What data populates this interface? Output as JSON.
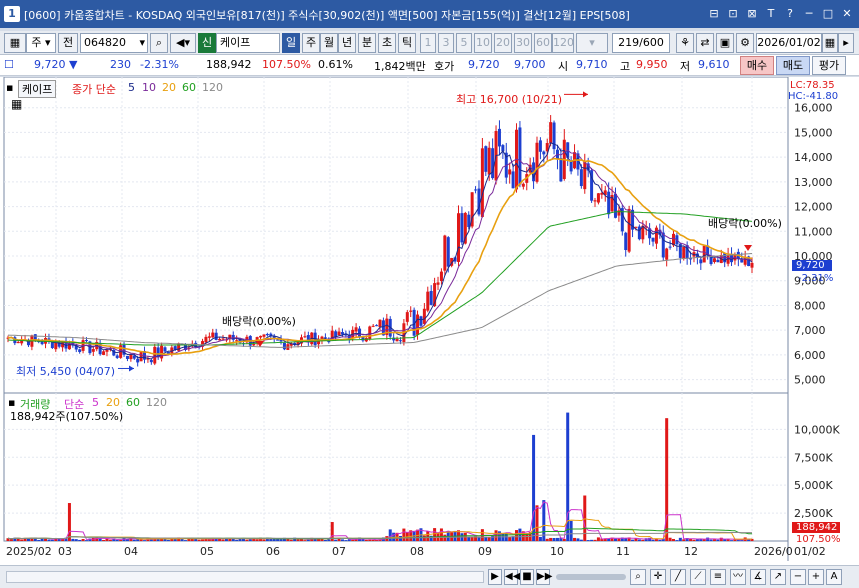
{
  "window": {
    "number": "1",
    "title": "[0600] 카움종합차트 - KOSDAQ 외국인보유[817(천)] 주식수[30,902(천)] 액면[500] 자본금[155(억)] 결산[12월] EPS[508]",
    "buttons": [
      "⊟",
      "⊡",
      "⊠",
      "T",
      "?",
      "─",
      "□",
      "✕"
    ]
  },
  "toolbar": {
    "market": "주",
    "all_label": "전",
    "code": "064820",
    "sin_label": "신",
    "name": "케이프",
    "periods": [
      "일",
      "주",
      "월",
      "년",
      "분",
      "초",
      "틱"
    ],
    "intervals": [
      "1",
      "3",
      "5",
      "10",
      "20",
      "30",
      "60",
      "120"
    ],
    "count": "219/600",
    "date": "2026/01/02"
  },
  "quote": {
    "price": "9,720",
    "change": "230",
    "change_pct": "-2.31%",
    "volume": "188,942",
    "volume_ratio": "107.50%",
    "turnover": "0.61%",
    "amount": "1,842백만",
    "ask_label": "호가",
    "ask1": "9,720",
    "ask2": "9,700",
    "open_label": "시",
    "open": "9,710",
    "high_label": "고",
    "high": "9,950",
    "low_label": "저",
    "low": "9,610",
    "buy_label": "매수",
    "sell_label": "매도",
    "eval_label": "평가"
  },
  "price_legend": {
    "name": "케이프",
    "type": "종가 단순",
    "ma": [
      "5",
      "10",
      "20",
      "60",
      "120"
    ]
  },
  "volume_legend": {
    "name": "거래량",
    "type": "단순",
    "ma": [
      "5",
      "20",
      "60",
      "120"
    ],
    "value": "188,942주(107.50%)"
  },
  "annotations": {
    "high": "최고 16,700 (10/21)",
    "low": "최저 5,450 (04/07)",
    "dividend1": "배당락(0.00%)",
    "dividend2": "배당락(0.00%)",
    "lc": "LC:78.35",
    "hc": "HC:-41.80",
    "price_box": "9,720",
    "price_pct": "-2.31%",
    "vol_box": "188,942",
    "vol_pct": "107.50%"
  },
  "axis": {
    "price_ticks": [
      "16,000",
      "15,000",
      "14,000",
      "13,000",
      "12,000",
      "11,000",
      "10,000",
      "9,000",
      "8,000",
      "7,000",
      "6,000",
      "5,000"
    ],
    "volume_ticks": [
      "10,000K",
      "7,500K",
      "5,000K",
      "2,500K"
    ],
    "x_ticks": [
      "2025/02",
      "03",
      "04",
      "05",
      "06",
      "07",
      "08",
      "09",
      "10",
      "11",
      "12",
      "2026/0",
      "01/02"
    ]
  },
  "colors": {
    "up": "#e01818",
    "down": "#1d3fd0",
    "ma5": "#1a2a8a",
    "ma10": "#7a2a9a",
    "ma20": "#e8a010",
    "ma60": "#22a022",
    "ma120": "#8a8a8a",
    "vol_ma5": "#cc33cc",
    "vol_ma20": "#e8a010",
    "vol_ma60": "#22a022",
    "vol_ma120": "#8a8a8a"
  },
  "chart_data": {
    "type": "candlestick",
    "period": "daily",
    "price_range": [
      4700,
      17000
    ],
    "volume_range": [
      0,
      12000000
    ],
    "months": [
      "2025/02",
      "03",
      "04",
      "05",
      "06",
      "07",
      "08",
      "09",
      "10",
      "11",
      "12",
      "01/02"
    ],
    "monthly_close": [
      6700,
      6400,
      5900,
      6700,
      6500,
      6800,
      7300,
      13500,
      14500,
      11200,
      10200,
      9720
    ],
    "monthly_high": [
      7200,
      7000,
      6900,
      7000,
      7300,
      7100,
      9700,
      15500,
      16700,
      14500,
      11600,
      10500
    ],
    "monthly_low": [
      6200,
      5900,
      5450,
      6100,
      6000,
      6200,
      6600,
      8900,
      11800,
      10300,
      9800,
      9610
    ],
    "price_ma20_monthly": [
      6800,
      6500,
      6000,
      6500,
      6500,
      6700,
      7200,
      12200,
      14600,
      11500,
      10300,
      9950
    ],
    "price_ma60_monthly": [
      6600,
      6500,
      6400,
      6400,
      6500,
      6600,
      6700,
      8500,
      11200,
      11800,
      11700,
      11400
    ],
    "price_ma120_monthly": [
      6800,
      6700,
      6500,
      6400,
      6300,
      6400,
      6500,
      7100,
      8600,
      9600,
      9900,
      10100
    ],
    "volume_spikes": [
      {
        "date": "2025/02",
        "volume": 3400000
      },
      {
        "date": "05",
        "volume": 1700000
      },
      {
        "date": "08",
        "volume": 9500000
      },
      {
        "date": "09",
        "volume": 11500000
      },
      {
        "date": "10",
        "volume": 11000000
      },
      {
        "date": "2026/01/02",
        "volume": 188942
      }
    ],
    "annotations": [
      {
        "label": "최고 16,700 (10/21)",
        "value": 16700,
        "date": "10/21"
      },
      {
        "label": "최저 5,450 (04/07)",
        "value": 5450,
        "date": "04/07"
      }
    ]
  }
}
